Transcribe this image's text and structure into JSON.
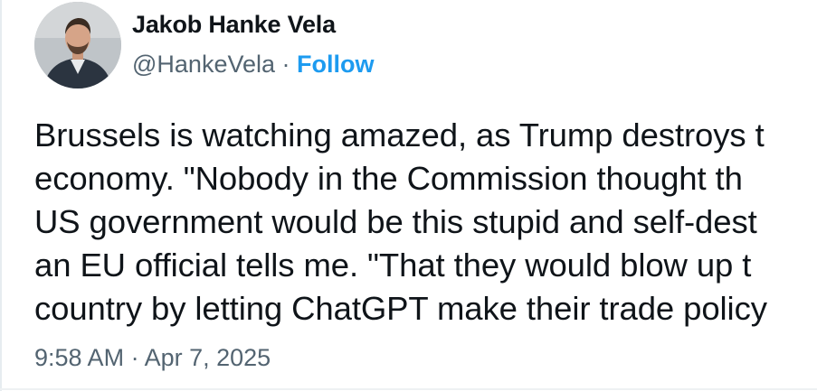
{
  "author": {
    "display_name": "Jakob Hanke Vela",
    "handle": "@HankeVela",
    "separator": "·",
    "follow_label": "Follow"
  },
  "tweet": {
    "lines": [
      "Brussels is watching amazed, as Trump destroys t",
      "economy.  \"Nobody in the Commission thought th",
      "US government would be this stupid and self-dest",
      "an EU official tells me. \"That they would blow up t",
      "country by letting ChatGPT make their trade policy"
    ]
  },
  "meta": {
    "time": "9:58 AM",
    "separator": "·",
    "date": "Apr 7, 2025"
  },
  "colors": {
    "accent": "#1d9bf0",
    "secondary_text": "#536471",
    "primary_text": "#0f1419"
  }
}
